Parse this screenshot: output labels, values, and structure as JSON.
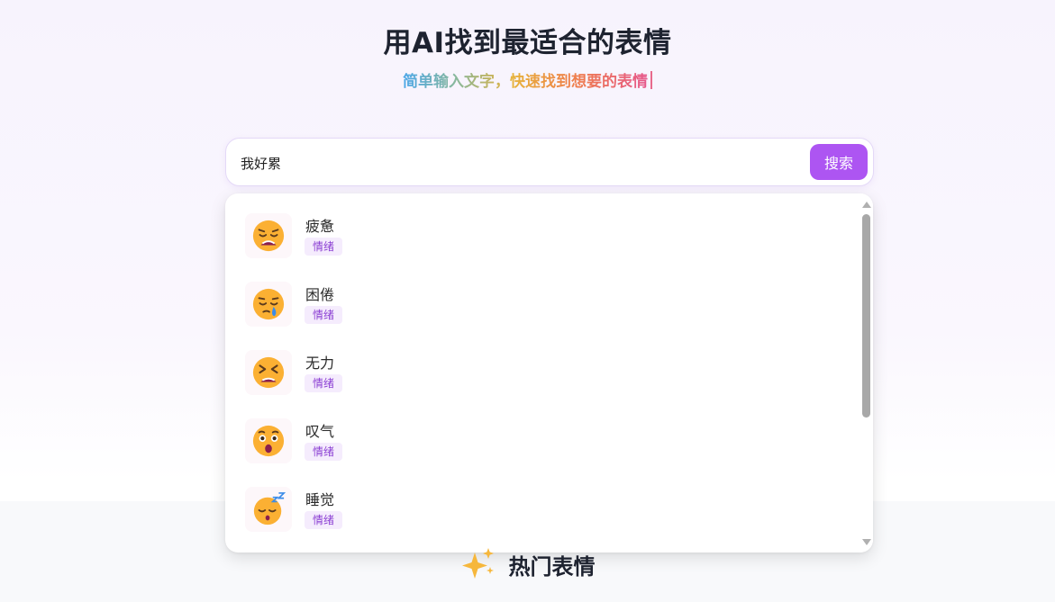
{
  "hero": {
    "title": "用AI找到最适合的表情",
    "subtitle": "简单输入文字，快速找到想要的表情"
  },
  "search": {
    "value": "我好累",
    "button_label": "搜索"
  },
  "results": [
    {
      "name": "疲惫",
      "tag": "情绪",
      "icon": "tired-face-icon"
    },
    {
      "name": "困倦",
      "tag": "情绪",
      "icon": "sleepy-face-icon"
    },
    {
      "name": "无力",
      "tag": "情绪",
      "icon": "tired-squint-face-icon"
    },
    {
      "name": "叹气",
      "tag": "情绪",
      "icon": "astonished-face-icon"
    },
    {
      "name": "睡觉",
      "tag": "情绪",
      "icon": "sleeping-face-icon"
    }
  ],
  "hot_section": {
    "title": "热门表情",
    "icon": "sparkles-icon"
  },
  "colors": {
    "accent": "#ad55f2",
    "tag_bg": "#f5ecfd",
    "tag_text": "#8b3fd3",
    "emoji_face": "#fbb033"
  }
}
